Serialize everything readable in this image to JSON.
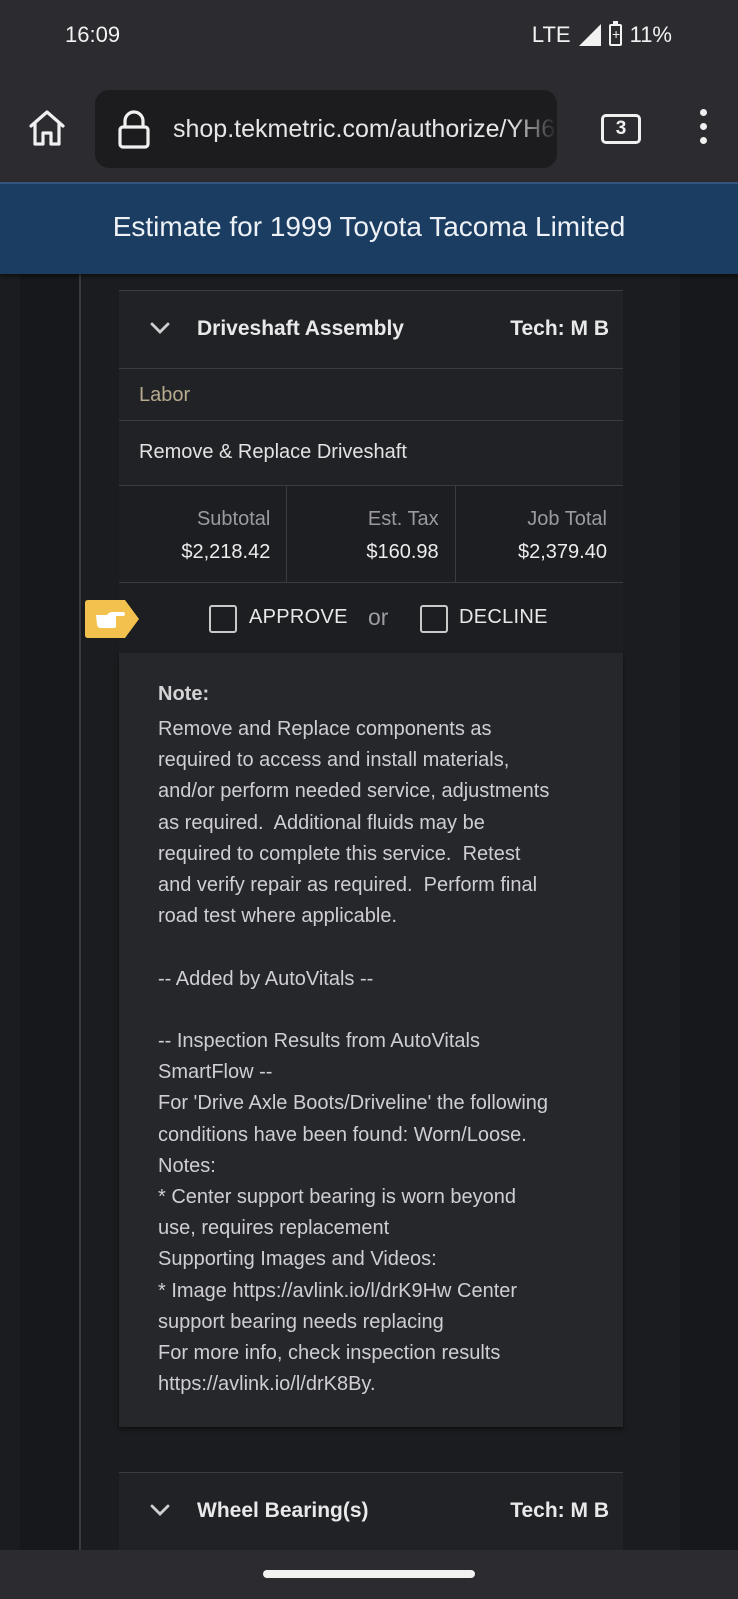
{
  "status_bar": {
    "time": "16:09",
    "network": "LTE",
    "battery": "11%"
  },
  "browser": {
    "url": "shop.tekmetric.com/authorize/YH6",
    "tab_count": "3"
  },
  "header": {
    "title": "Estimate for 1999 Toyota Tacoma Limited"
  },
  "jobs": [
    {
      "title": "Driveshaft Assembly",
      "tech": "Tech: M B",
      "section_label": "Labor",
      "labor_item": "Remove & Replace Driveshaft",
      "totals": [
        {
          "label": "Subtotal",
          "value": "$2,218.42"
        },
        {
          "label": "Est. Tax",
          "value": "$160.98"
        },
        {
          "label": "Job Total",
          "value": "$2,379.40"
        }
      ],
      "approve_label": "APPROVE",
      "or_label": "or",
      "decline_label": "DECLINE",
      "note_heading": "Note:",
      "note_body": "Remove and Replace components as\nrequired to access and install materials,\nand/or perform needed service, adjustments\nas required.  Additional fluids may be\nrequired to complete this service.  Retest\nand verify repair as required.  Perform final\nroad test where applicable.\n\n-- Added by AutoVitals --\n\n-- Inspection Results from AutoVitals\nSmartFlow --\nFor 'Drive Axle Boots/Driveline' the following\nconditions have been found: Worn/Loose.\nNotes:\n* Center support bearing is worn beyond\nuse, requires replacement\nSupporting Images and Videos:\n* Image https://avlink.io/l/drK9Hw Center\nsupport bearing needs replacing\nFor more info, check inspection results\nhttps://avlink.io/l/drK8By."
    },
    {
      "title": "Wheel Bearing(s)",
      "tech": "Tech: M B"
    }
  ],
  "colors": {
    "header_bg": "#1c3d62",
    "pointer_tag": "#f2c14e",
    "labor_label": "#b7aa8e"
  },
  "icons": [
    "home-icon",
    "lock-icon",
    "tabs-icon",
    "more-vert-icon",
    "chevron-down-icon",
    "hand-pointer-icon",
    "signal-icon",
    "battery-icon"
  ]
}
